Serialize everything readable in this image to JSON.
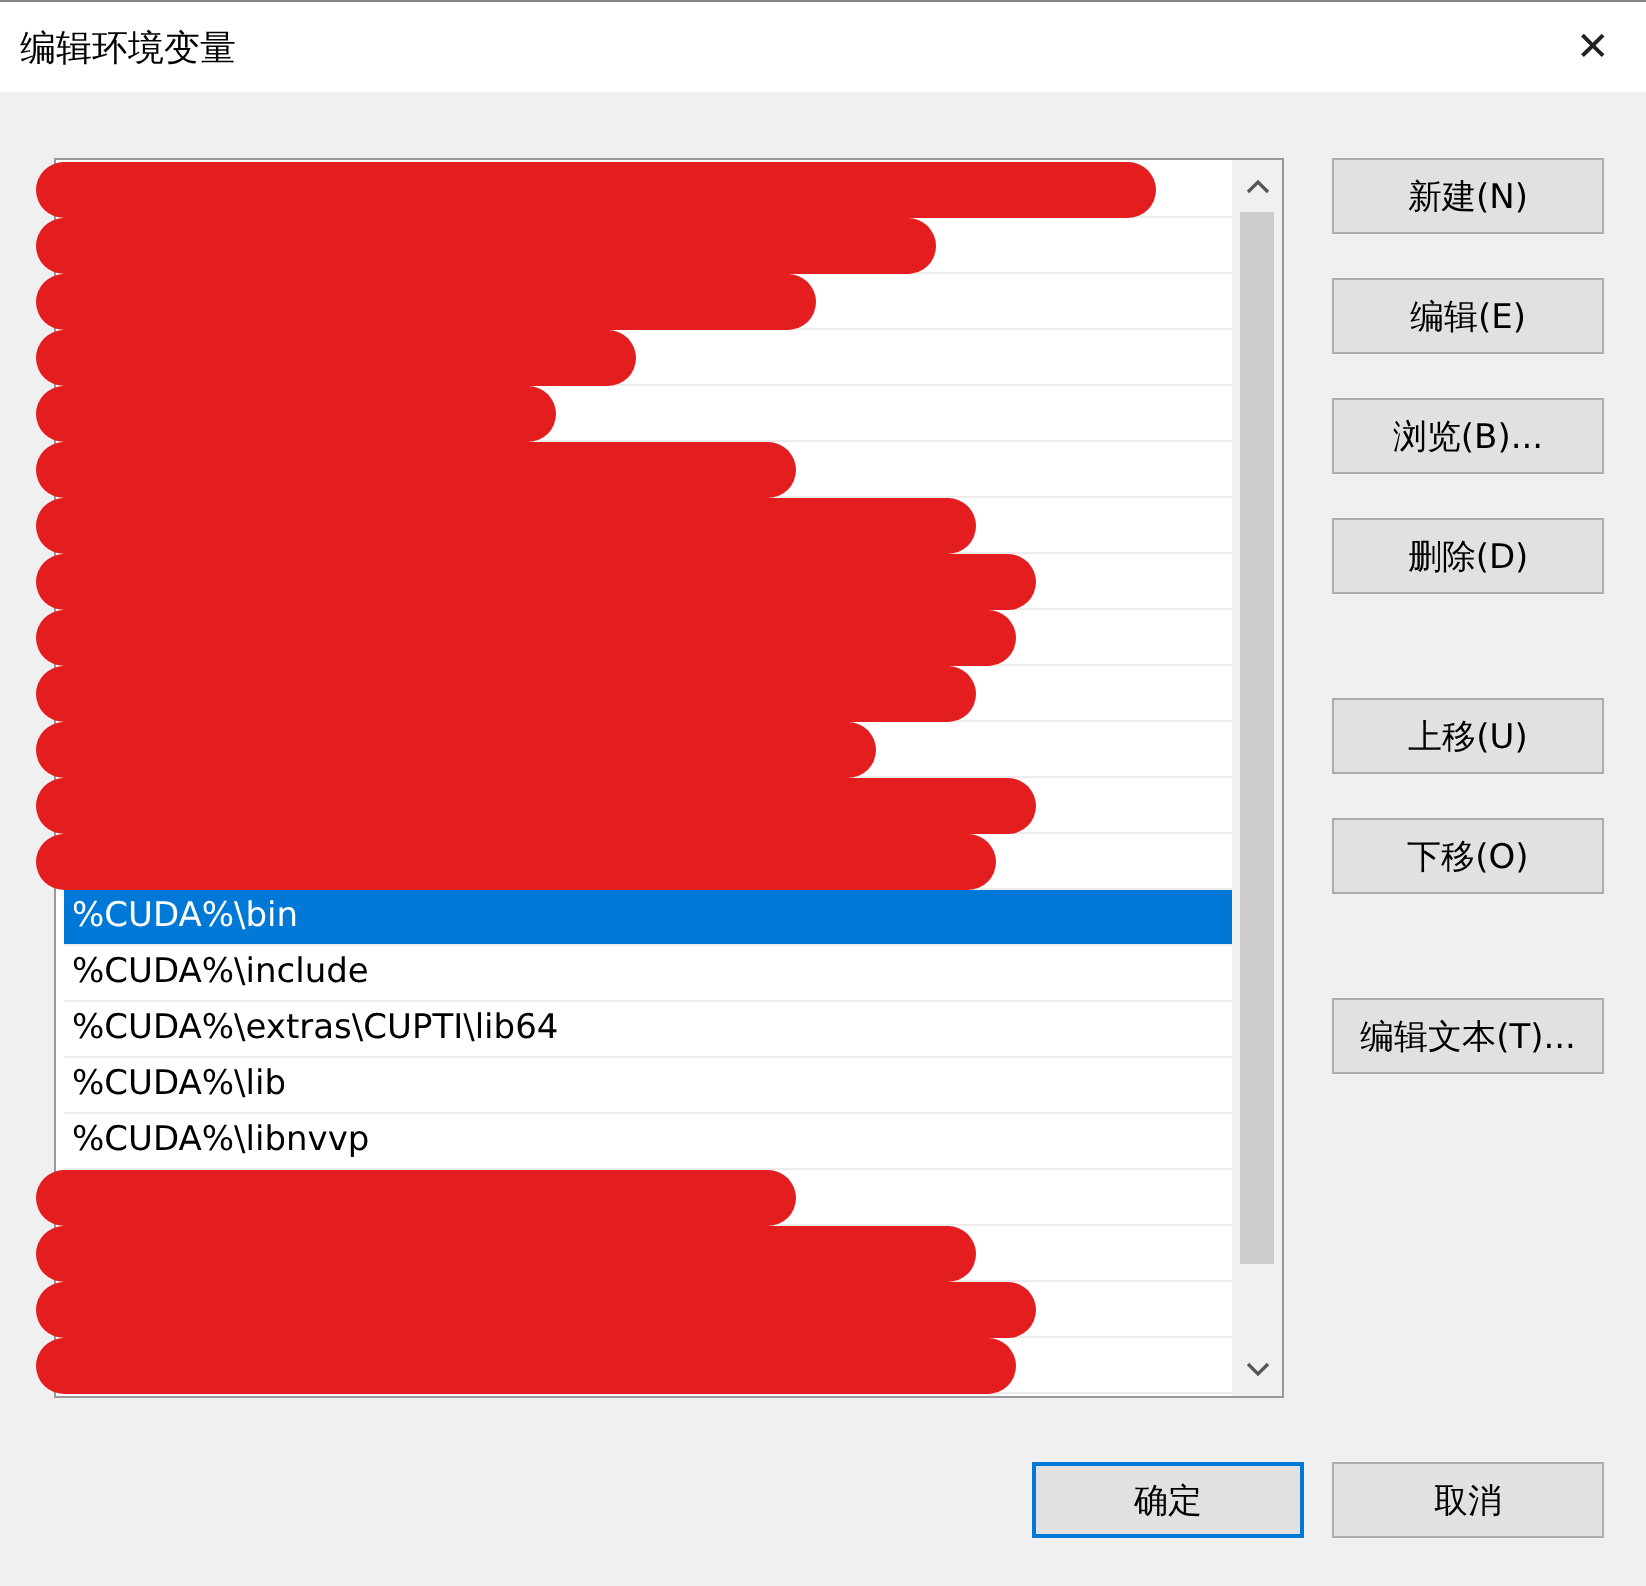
{
  "window": {
    "title": "编辑环境变量",
    "close": "✕"
  },
  "path_list": {
    "rows": [
      {
        "redacted": true,
        "selected": false
      },
      {
        "redacted": true,
        "selected": false
      },
      {
        "redacted": true,
        "selected": false
      },
      {
        "redacted": true,
        "selected": false
      },
      {
        "redacted": true,
        "selected": false
      },
      {
        "redacted": true,
        "selected": false
      },
      {
        "redacted": true,
        "selected": false
      },
      {
        "redacted": true,
        "selected": false
      },
      {
        "redacted": true,
        "selected": false
      },
      {
        "redacted": true,
        "selected": false
      },
      {
        "redacted": true,
        "selected": false
      },
      {
        "redacted": true,
        "selected": false
      },
      {
        "redacted": true,
        "selected": false
      },
      {
        "text": "%CUDA%\\bin",
        "redacted": false,
        "selected": true
      },
      {
        "text": "%CUDA%\\include",
        "redacted": false,
        "selected": false
      },
      {
        "text": "%CUDA%\\extras\\CUPTI\\lib64",
        "redacted": false,
        "selected": false
      },
      {
        "text": "%CUDA%\\lib",
        "redacted": false,
        "selected": false
      },
      {
        "text": "%CUDA%\\libnvvp",
        "redacted": false,
        "selected": false
      },
      {
        "redacted": true,
        "selected": false
      },
      {
        "redacted": true,
        "selected": false
      },
      {
        "redacted": true,
        "selected": false
      },
      {
        "redacted": true,
        "selected": false
      }
    ]
  },
  "side_buttons": [
    {
      "label": "新建(N)"
    },
    {
      "label": "编辑(E)"
    },
    {
      "label": "浏览(B)..."
    },
    {
      "label": "删除(D)"
    },
    {
      "label": "上移(U)"
    },
    {
      "label": "下移(O)"
    },
    {
      "label": "编辑文本(T)..."
    }
  ],
  "footer_buttons": [
    {
      "label": "确定",
      "default": true
    },
    {
      "label": "取消",
      "default": false
    }
  ]
}
